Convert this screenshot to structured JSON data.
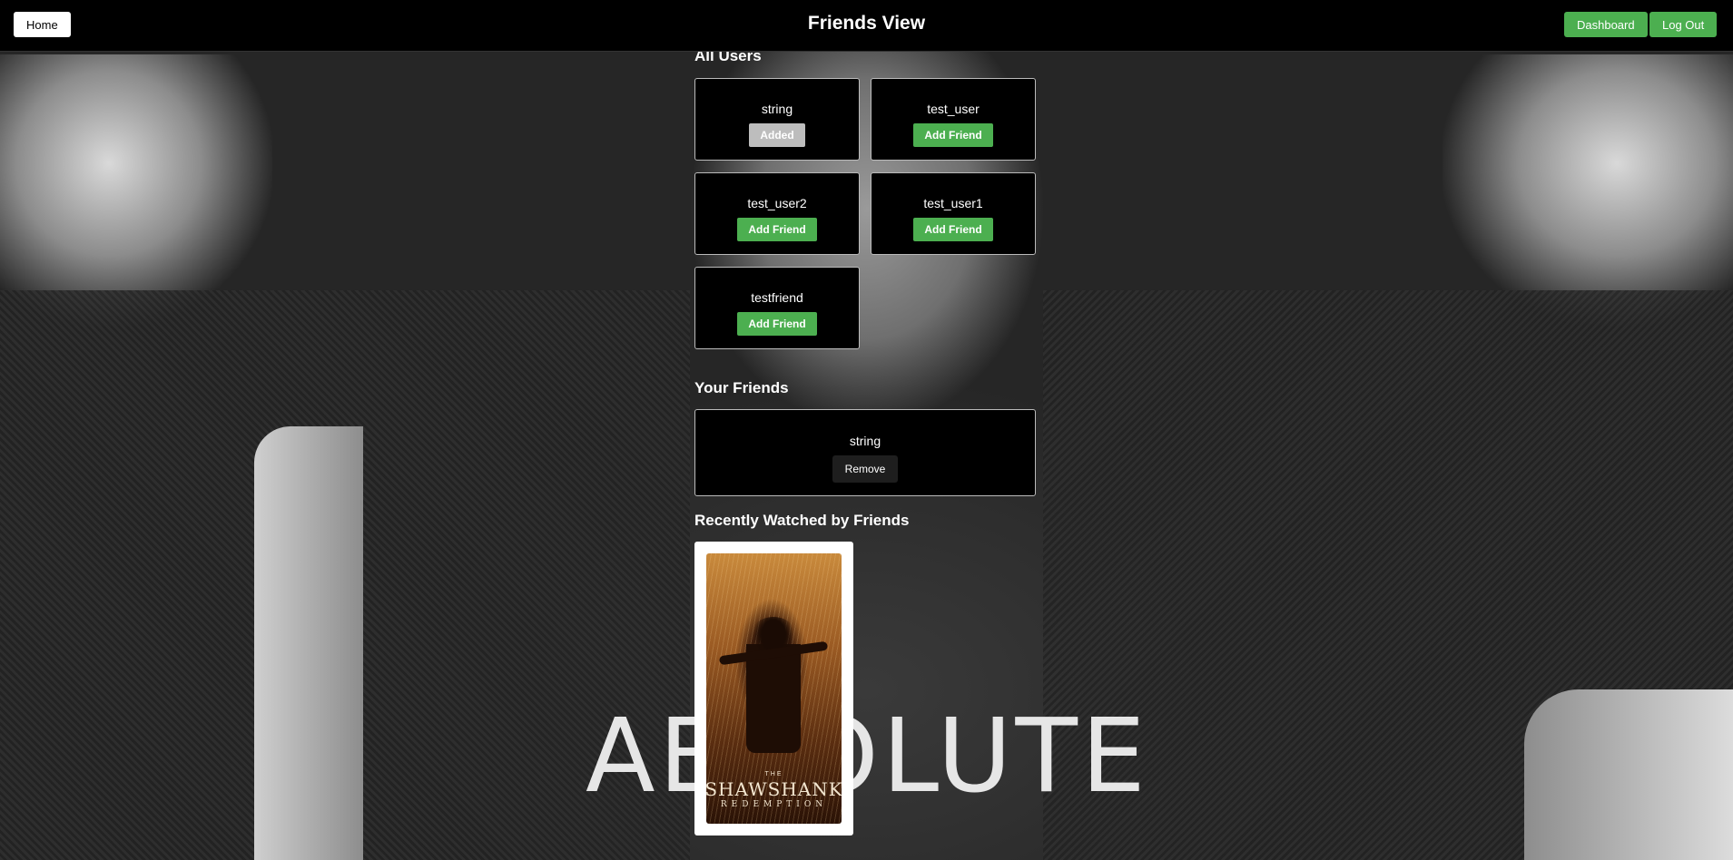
{
  "header": {
    "home_label": "Home",
    "title": "Friends View",
    "dashboard_label": "Dashboard",
    "logout_label": "Log Out"
  },
  "all_users": {
    "title": "All Users",
    "users": [
      {
        "name": "string",
        "action": "Added"
      },
      {
        "name": "test_user",
        "action": "Add Friend"
      },
      {
        "name": "test_user2",
        "action": "Add Friend"
      },
      {
        "name": "test_user1",
        "action": "Add Friend"
      },
      {
        "name": "testfriend",
        "action": "Add Friend"
      }
    ]
  },
  "your_friends": {
    "title": "Your Friends",
    "friends": [
      {
        "name": "string",
        "action": "Remove"
      }
    ]
  },
  "recently_watched": {
    "title": "Recently Watched by Friends",
    "movies": [
      {
        "poster_the": "THE",
        "poster_name": "SHAWSHANK",
        "poster_sub": "REDEMPTION"
      }
    ]
  },
  "background": {
    "text": "ABSOLUTE"
  },
  "colors": {
    "topbar": "#000000",
    "add_button": "#4caf50",
    "added_button": "#bdbdbd",
    "remove_button": "#1e1e1e",
    "card_bg": "#000000"
  }
}
